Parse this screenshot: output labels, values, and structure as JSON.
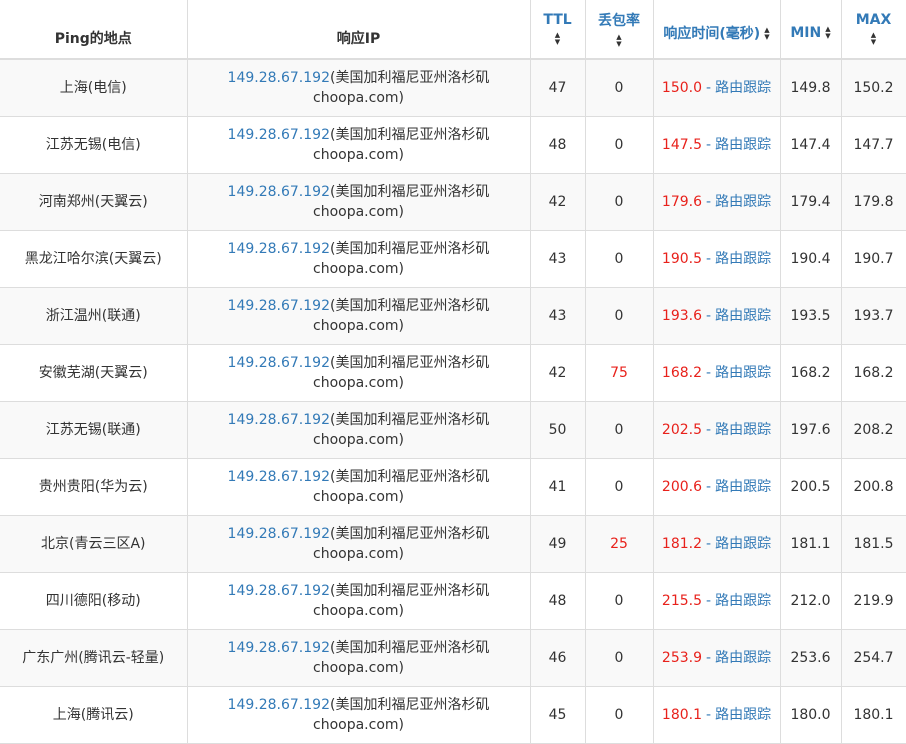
{
  "header": {
    "location": "Ping的地点",
    "ip": "响应IP",
    "ttl": "TTL",
    "loss": "丢包率",
    "time": "响应时间(毫秒)",
    "min": "MIN",
    "max": "MAX"
  },
  "trace_label": "路由跟踪",
  "separator": "-",
  "colors": {
    "link": "#337ab7",
    "alert": "#e8211b"
  },
  "rows": [
    {
      "location": "上海(电信)",
      "ip": "149.28.67.192",
      "ip_info": "(美国加利福尼亚州洛杉矶choopa.com)",
      "ttl": "47",
      "loss": "0",
      "time": "150.0",
      "min": "149.8",
      "max": "150.2"
    },
    {
      "location": "江苏无锡(电信)",
      "ip": "149.28.67.192",
      "ip_info": "(美国加利福尼亚州洛杉矶choopa.com)",
      "ttl": "48",
      "loss": "0",
      "time": "147.5",
      "min": "147.4",
      "max": "147.7"
    },
    {
      "location": "河南郑州(天翼云)",
      "ip": "149.28.67.192",
      "ip_info": "(美国加利福尼亚州洛杉矶choopa.com)",
      "ttl": "42",
      "loss": "0",
      "time": "179.6",
      "min": "179.4",
      "max": "179.8"
    },
    {
      "location": "黑龙江哈尔滨(天翼云)",
      "ip": "149.28.67.192",
      "ip_info": "(美国加利福尼亚州洛杉矶choopa.com)",
      "ttl": "43",
      "loss": "0",
      "time": "190.5",
      "min": "190.4",
      "max": "190.7"
    },
    {
      "location": "浙江温州(联通)",
      "ip": "149.28.67.192",
      "ip_info": "(美国加利福尼亚州洛杉矶choopa.com)",
      "ttl": "43",
      "loss": "0",
      "time": "193.6",
      "min": "193.5",
      "max": "193.7"
    },
    {
      "location": "安徽芜湖(天翼云)",
      "ip": "149.28.67.192",
      "ip_info": "(美国加利福尼亚州洛杉矶choopa.com)",
      "ttl": "42",
      "loss": "75",
      "time": "168.2",
      "min": "168.2",
      "max": "168.2"
    },
    {
      "location": "江苏无锡(联通)",
      "ip": "149.28.67.192",
      "ip_info": "(美国加利福尼亚州洛杉矶choopa.com)",
      "ttl": "50",
      "loss": "0",
      "time": "202.5",
      "min": "197.6",
      "max": "208.2"
    },
    {
      "location": "贵州贵阳(华为云)",
      "ip": "149.28.67.192",
      "ip_info": "(美国加利福尼亚州洛杉矶choopa.com)",
      "ttl": "41",
      "loss": "0",
      "time": "200.6",
      "min": "200.5",
      "max": "200.8"
    },
    {
      "location": "北京(青云三区A)",
      "ip": "149.28.67.192",
      "ip_info": "(美国加利福尼亚州洛杉矶choopa.com)",
      "ttl": "49",
      "loss": "25",
      "time": "181.2",
      "min": "181.1",
      "max": "181.5"
    },
    {
      "location": "四川德阳(移动)",
      "ip": "149.28.67.192",
      "ip_info": "(美国加利福尼亚州洛杉矶choopa.com)",
      "ttl": "48",
      "loss": "0",
      "time": "215.5",
      "min": "212.0",
      "max": "219.9"
    },
    {
      "location": "广东广州(腾讯云-轻量)",
      "ip": "149.28.67.192",
      "ip_info": "(美国加利福尼亚州洛杉矶choopa.com)",
      "ttl": "46",
      "loss": "0",
      "time": "253.9",
      "min": "253.6",
      "max": "254.7"
    },
    {
      "location": "上海(腾讯云)",
      "ip": "149.28.67.192",
      "ip_info": "(美国加利福尼亚州洛杉矶choopa.com)",
      "ttl": "45",
      "loss": "0",
      "time": "180.1",
      "min": "180.0",
      "max": "180.1"
    }
  ]
}
